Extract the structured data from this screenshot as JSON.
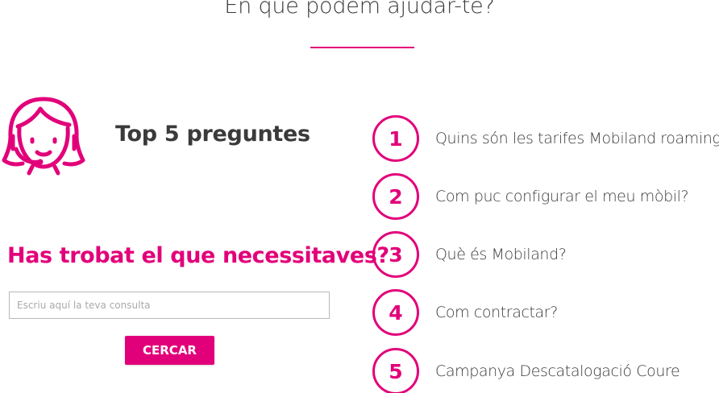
{
  "header": {
    "title": "En què podem ajudar-te?"
  },
  "help": {
    "icon": "support-agent-icon",
    "top_heading": "Top 5 preguntes",
    "found_heading": "Has trobat el que necessitaves?",
    "search": {
      "placeholder": "Escriu aquí la teva consulta",
      "value": ""
    },
    "search_button_label": "CERCAR"
  },
  "faq": {
    "items": [
      {
        "number": "1",
        "question": "Quins són les tarifes Mobiland roaming?"
      },
      {
        "number": "2",
        "question": "Com puc configurar el meu mòbil?"
      },
      {
        "number": "3",
        "question": "Què és Mobiland?"
      },
      {
        "number": "4",
        "question": "Com contractar?"
      },
      {
        "number": "5",
        "question": "Campanya Descatalogació Coure"
      }
    ]
  },
  "colors": {
    "accent": "#e2007a",
    "text": "#3a3a3a",
    "background": "#ffffff"
  }
}
